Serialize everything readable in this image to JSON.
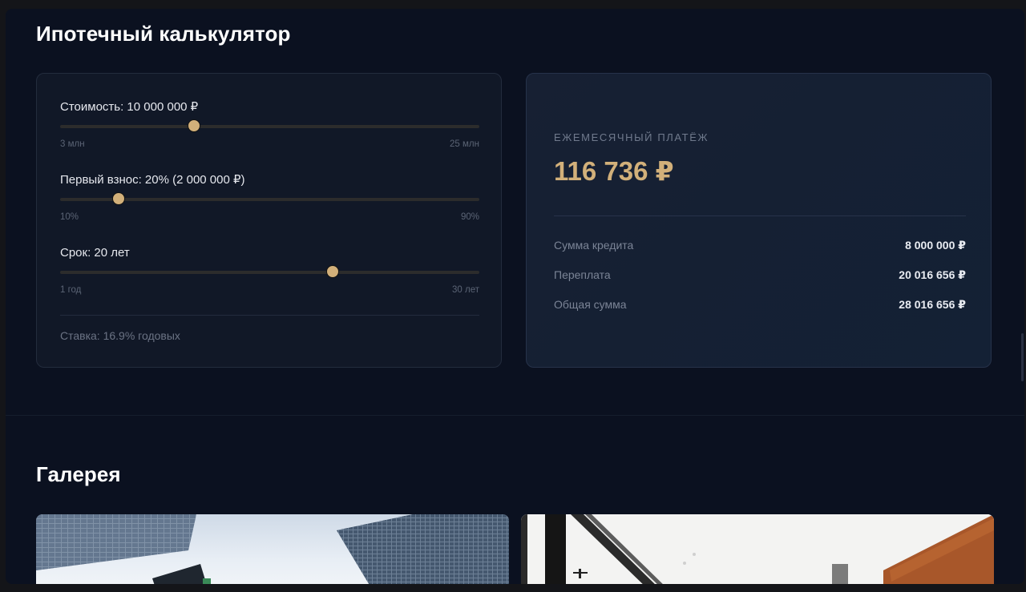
{
  "calculator": {
    "title": "Ипотечный калькулятор",
    "sliders": [
      {
        "label": "Стоимость: 10 000 000 ₽",
        "min_label": "3 млн",
        "max_label": "25 млн",
        "value_fraction": 0.32
      },
      {
        "label": "Первый взнос: 20% (2 000 000 ₽)",
        "min_label": "10%",
        "max_label": "90%",
        "value_fraction": 0.14
      },
      {
        "label": "Срок: 20 лет",
        "min_label": "1 год",
        "max_label": "30 лет",
        "value_fraction": 0.65
      }
    ],
    "rate": "Ставка: 16.9% годовых"
  },
  "result": {
    "payment_label": "ЕЖЕМЕСЯЧНЫЙ ПЛАТЁЖ",
    "payment_value": "116 736 ₽",
    "rows": [
      {
        "label": "Сумма кредита",
        "value": "8 000 000 ₽"
      },
      {
        "label": "Переплата",
        "value": "20 016 656 ₽"
      },
      {
        "label": "Общая сумма",
        "value": "28 016 656 ₽"
      }
    ]
  },
  "gallery": {
    "title": "Галерея"
  },
  "colors": {
    "accent": "#d2b07a",
    "background": "#0b1120",
    "card": "#111827"
  }
}
